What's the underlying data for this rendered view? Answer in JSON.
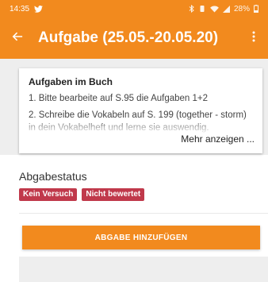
{
  "status_bar": {
    "time": "14:35",
    "battery": "28%",
    "icons": [
      "twitter-icon",
      "bluetooth-icon",
      "vibrate-icon",
      "wifi-icon",
      "signal-icon",
      "battery-icon"
    ]
  },
  "app_bar": {
    "title": "Aufgabe (25.05.-20.05.20)",
    "back_icon": "arrow-left-icon",
    "menu_icon": "more-vert-icon"
  },
  "task_card": {
    "heading": "Aufgaben im Buch",
    "lines": [
      "1. Bitte bearbeite auf S.95 die Aufgaben 1+2",
      "2. Schreibe die Vokabeln auf S. 199 (together - storm) in dein Vokabelheft und lerne sie auswendig."
    ],
    "more_label": "Mehr anzeigen ..."
  },
  "submission": {
    "status_label": "Abgabestatus",
    "badges": [
      "Kein Versuch",
      "Nicht bewertet"
    ],
    "add_button_label": "ABGABE HINZUFÜGEN"
  },
  "colors": {
    "accent": "#f28a1e",
    "badge": "#c0394b",
    "pane_bg": "#eeeeee"
  }
}
